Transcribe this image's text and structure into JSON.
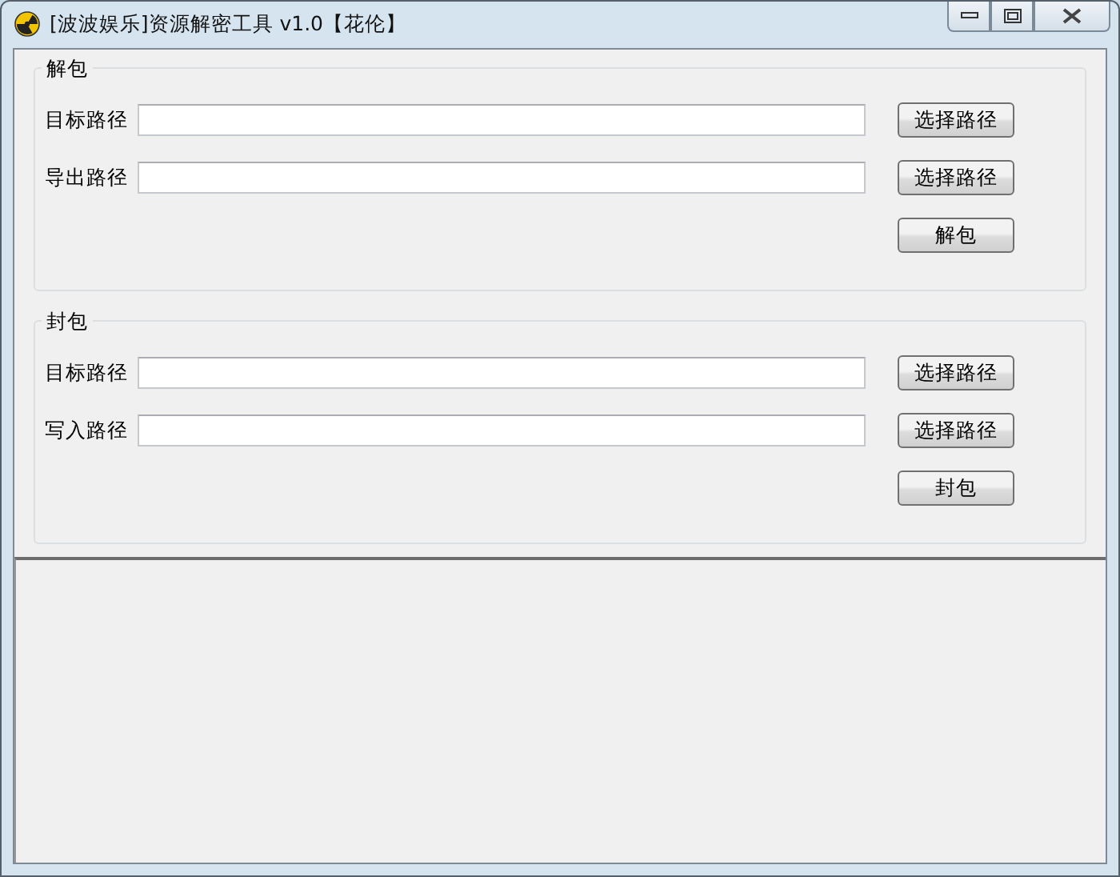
{
  "window": {
    "title": "[波波娱乐]资源解密工具 v1.0【花伦】"
  },
  "sections": [
    {
      "title": "解包",
      "rows": [
        {
          "label": "目标路径",
          "button": "选择路径"
        },
        {
          "label": "导出路径",
          "button": "选择路径"
        }
      ],
      "action": "解包"
    },
    {
      "title": "封包",
      "rows": [
        {
          "label": "目标路径",
          "button": "选择路径"
        },
        {
          "label": "写入路径",
          "button": "选择路径"
        }
      ],
      "action": "封包"
    }
  ]
}
